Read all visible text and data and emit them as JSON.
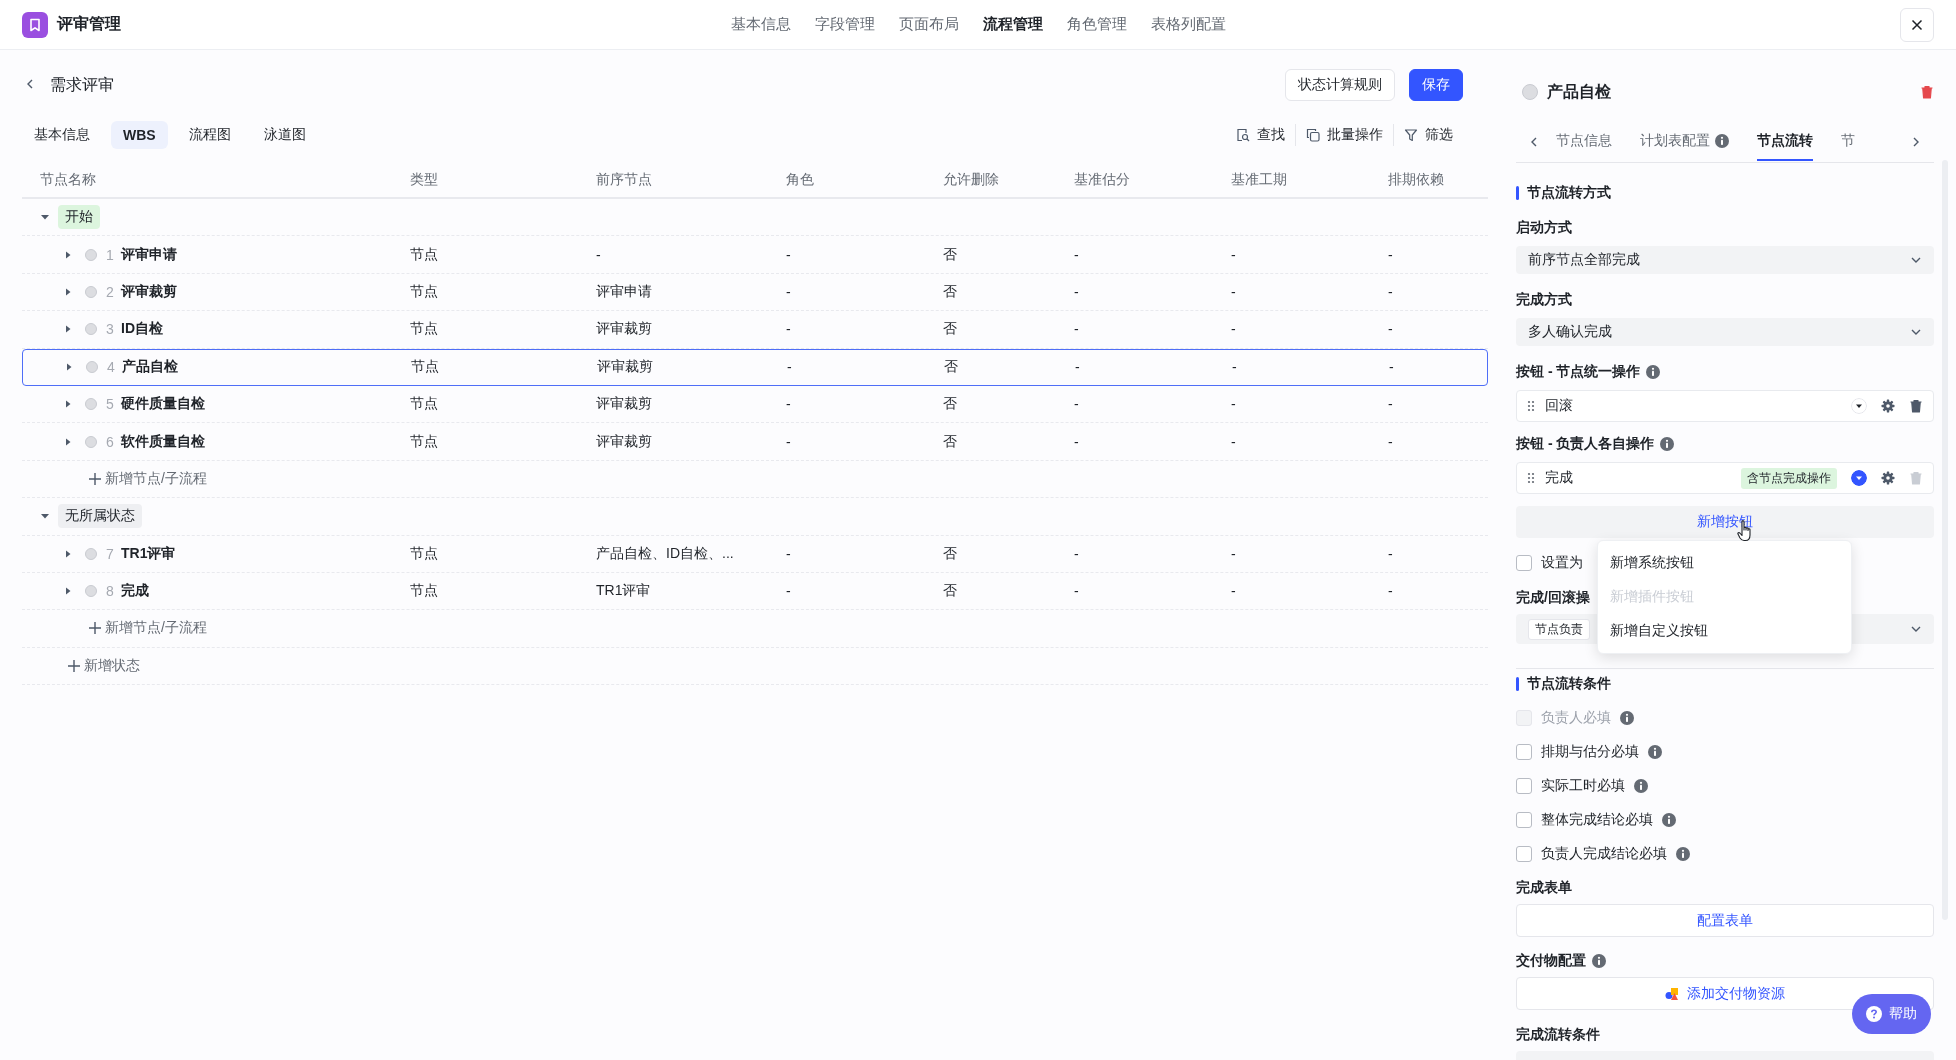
{
  "app": {
    "title": "评审管理"
  },
  "top_nav": [
    {
      "label": "基本信息",
      "selected": false
    },
    {
      "label": "字段管理",
      "selected": false
    },
    {
      "label": "页面布局",
      "selected": false
    },
    {
      "label": "流程管理",
      "selected": true
    },
    {
      "label": "角色管理",
      "selected": false
    },
    {
      "label": "表格列配置",
      "selected": false
    }
  ],
  "page": {
    "title": "需求评审",
    "buttons": [
      {
        "label": "状态计算规则",
        "kind": "default"
      },
      {
        "label": "保存",
        "kind": "primary"
      }
    ]
  },
  "view_tabs": [
    {
      "label": "基本信息",
      "selected": false
    },
    {
      "label": "WBS",
      "selected": true
    },
    {
      "label": "流程图",
      "selected": false
    },
    {
      "label": "泳道图",
      "selected": false
    }
  ],
  "toolbar": [
    {
      "label": "查找",
      "kind": "find"
    },
    {
      "label": "批量操作",
      "kind": "batch"
    },
    {
      "label": "筛选",
      "kind": "filter"
    }
  ],
  "table": {
    "columns": [
      "节点名称",
      "类型",
      "前序节点",
      "角色",
      "允许删除",
      "基准估分",
      "基准工期",
      "排期依赖"
    ],
    "groups": [
      {
        "label": "开始",
        "color": "#dcf5de",
        "expanded": true,
        "add_label": "新增节点/子流程",
        "rows": [
          {
            "number": "1",
            "name": "评审申请",
            "expanded": false,
            "selected": false,
            "cells": [
              "节点",
              "-",
              "-",
              "否",
              "-",
              "-",
              "-"
            ]
          },
          {
            "number": "2",
            "name": "评审裁剪",
            "expanded": false,
            "selected": false,
            "cells": [
              "节点",
              "评审申请",
              "-",
              "否",
              "-",
              "-",
              "-"
            ]
          },
          {
            "number": "3",
            "name": "ID自检",
            "expanded": false,
            "selected": false,
            "cells": [
              "节点",
              "评审裁剪",
              "-",
              "否",
              "-",
              "-",
              "-"
            ]
          },
          {
            "number": "4",
            "name": "产品自检",
            "expanded": false,
            "selected": true,
            "cells": [
              "节点",
              "评审裁剪",
              "-",
              "否",
              "-",
              "-",
              "-"
            ]
          },
          {
            "number": "5",
            "name": "硬件质量自检",
            "expanded": false,
            "selected": false,
            "cells": [
              "节点",
              "评审裁剪",
              "-",
              "否",
              "-",
              "-",
              "-"
            ]
          },
          {
            "number": "6",
            "name": "软件质量自检",
            "expanded": false,
            "selected": false,
            "cells": [
              "节点",
              "评审裁剪",
              "-",
              "否",
              "-",
              "-",
              "-"
            ]
          }
        ]
      },
      {
        "label": "无所属状态",
        "color": "#eeeff2",
        "expanded": true,
        "add_label": "新增节点/子流程",
        "rows": [
          {
            "number": "7",
            "name": "TR1评审",
            "expanded": false,
            "selected": false,
            "cells": [
              "节点",
              "产品自检、ID自检、...",
              "-",
              "否",
              "-",
              "-",
              "-"
            ]
          },
          {
            "number": "8",
            "name": "完成",
            "expanded": false,
            "selected": false,
            "cells": [
              "节点",
              "TR1评审",
              "-",
              "否",
              "-",
              "-",
              "-"
            ]
          }
        ]
      }
    ],
    "add_state": "新增状态"
  },
  "detail": {
    "title": "产品自检",
    "tabs": [
      {
        "label": "节点信息",
        "selected": false,
        "info": false
      },
      {
        "label": "计划表配置",
        "selected": false,
        "info": true
      },
      {
        "label": "节点流转",
        "selected": true,
        "info": false
      },
      {
        "label": "节",
        "selected": false,
        "info": false
      }
    ],
    "flow_heading": "节点流转方式",
    "selects": [
      {
        "label": "启动方式",
        "value": "前序节点全部完成"
      },
      {
        "label": "完成方式",
        "value": "多人确认完成"
      }
    ],
    "button_groups": [
      {
        "label": "按钮 - 节点统一操作",
        "items": [
          {
            "label": "回滚",
            "highlighted": false,
            "deletable": true
          }
        ]
      },
      {
        "label": "按钮 - 负责人各自操作",
        "items": [
          {
            "label": "完成",
            "tag": "含节点完成操作",
            "highlighted": true,
            "deletable": false
          }
        ]
      }
    ],
    "add_button": "新增按钮",
    "add_menu": [
      {
        "label": "新增系统按钮",
        "disabled": false
      },
      {
        "label": "新增插件按钮",
        "disabled": true
      },
      {
        "label": "新增自定义按钮",
        "disabled": false
      }
    ],
    "limit_checkbox": {
      "label": "设置为",
      "checked": false
    },
    "operator": {
      "label": "完成/回滚操",
      "tag": "节点负责"
    },
    "conditions_heading": "节点流转条件",
    "conditions": [
      {
        "label": "负责人必填",
        "checked": false,
        "disabled": true
      },
      {
        "label": "排期与估分必填",
        "checked": false,
        "disabled": false
      },
      {
        "label": "实际工时必填",
        "checked": false,
        "disabled": false
      },
      {
        "label": "整体完成结论必填",
        "checked": false,
        "disabled": false
      },
      {
        "label": "负责人完成结论必填",
        "checked": false,
        "disabled": false
      }
    ],
    "form": {
      "label": "完成表单",
      "button": "配置表单"
    },
    "deliverable": {
      "label": "交付物配置",
      "button": "添加交付物资源"
    },
    "complete_conditions": {
      "label": "完成流转条件"
    }
  },
  "help": "帮助"
}
